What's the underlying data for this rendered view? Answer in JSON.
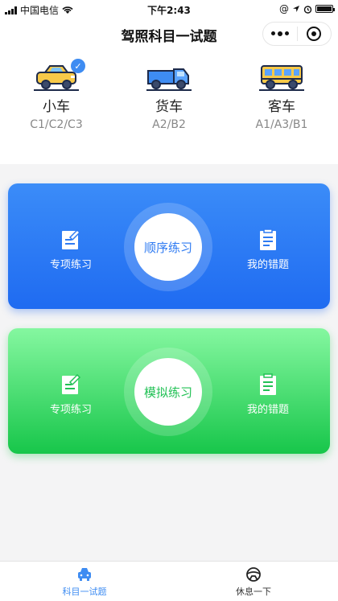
{
  "status": {
    "carrier": "中国电信",
    "time": "下午2:43"
  },
  "nav": {
    "title": "驾照科目一试题"
  },
  "vehicles": [
    {
      "name": "小车",
      "license": "C1/C2/C3",
      "selected": true,
      "icon": "car-icon"
    },
    {
      "name": "货车",
      "license": "A2/B2",
      "selected": false,
      "icon": "truck-icon"
    },
    {
      "name": "客车",
      "license": "A1/A3/B1",
      "selected": false,
      "icon": "bus-icon"
    }
  ],
  "cards": {
    "sequence": {
      "left": "专项练习",
      "center": "顺序练习",
      "right": "我的错题"
    },
    "mock": {
      "left": "专项练习",
      "center": "模拟练习",
      "right": "我的错题"
    }
  },
  "colors": {
    "accent": "#3e8cf2",
    "blue": "#2f7bf2",
    "green": "#22c155"
  },
  "tabs": [
    {
      "label": "科目一试题",
      "active": true
    },
    {
      "label": "休息一下",
      "active": false
    }
  ]
}
